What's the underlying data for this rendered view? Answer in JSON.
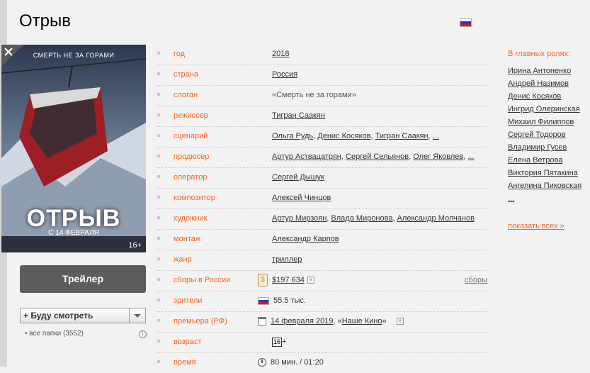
{
  "page": {
    "title": "Отрыв"
  },
  "poster": {
    "tagline": "СМЕРТЬ НЕ ЗА ГОРАМИ",
    "name": "ОТРЫВ",
    "date": "С 14 ФЕВРАЛЯ",
    "age": "16+"
  },
  "buttons": {
    "trailer": "Трейлер"
  },
  "watchlist": {
    "label": "+ Буду смотреть",
    "folders": "• все папки (3552)"
  },
  "info": {
    "year": {
      "label": "год",
      "value": "2018"
    },
    "country": {
      "label": "страна",
      "value": "Россия"
    },
    "slogan": {
      "label": "слоган",
      "value": "«Смерть не за горами»"
    },
    "director": {
      "label": "режиссер",
      "values": [
        "Тигран Саакян"
      ]
    },
    "writer": {
      "label": "сценарий",
      "values": [
        "Ольга Рудь",
        "Денис Косяков",
        "Тигран Саакян",
        "..."
      ]
    },
    "producer": {
      "label": "продюсер",
      "values": [
        "Артур Аствацатрян",
        "Сергей Сельянов",
        "Олег Яковлев",
        "..."
      ]
    },
    "operator": {
      "label": "оператор",
      "values": [
        "Сергей Дышук"
      ]
    },
    "composer": {
      "label": "композитор",
      "values": [
        "Алексей Чинцов"
      ]
    },
    "artist": {
      "label": "художник",
      "values": [
        "Артур Мирзоян",
        "Влада Миронова",
        "Александр Молчанов"
      ]
    },
    "editor": {
      "label": "монтаж",
      "values": [
        "Александр Карпов"
      ]
    },
    "genre": {
      "label": "жанр",
      "value": "триллер"
    },
    "boxoffice": {
      "label": "сборы в России",
      "value": "$197 634",
      "link": "сборы"
    },
    "viewers": {
      "label": "зрители",
      "value": "55.5 тыс."
    },
    "premiere": {
      "label": "премьера (РФ)",
      "date": "14 февраля 2019",
      "distributor_prefix": ", «",
      "distributor": "Наше Кино",
      "distributor_suffix": "»"
    },
    "age": {
      "label": "возраст",
      "value": "16",
      "plus": "+"
    },
    "time": {
      "label": "время",
      "value": "80 мин. / 01:20"
    }
  },
  "actors": {
    "heading": "В главных ролях:",
    "list": [
      "Ирина Антоненко",
      "Андрей Назимов",
      "Денис Косяков",
      "Ингрид Олеринская",
      "Михаил Филиппов",
      "Сергей Тодоров",
      "Владимир Гусев",
      "Елена Ветрова",
      "Виктория Пятакина",
      "Ангелина Пиковская",
      "..."
    ],
    "show_all": "показать всех",
    "show_all_arrow": "»"
  },
  "icons": {
    "flag": "russia-flag-icon",
    "money": "money-icon",
    "calendar": "calendar-icon",
    "clock": "clock-icon"
  },
  "colors": {
    "label_orange": "#f26522",
    "trailer_bg": "#5c5c5c"
  }
}
